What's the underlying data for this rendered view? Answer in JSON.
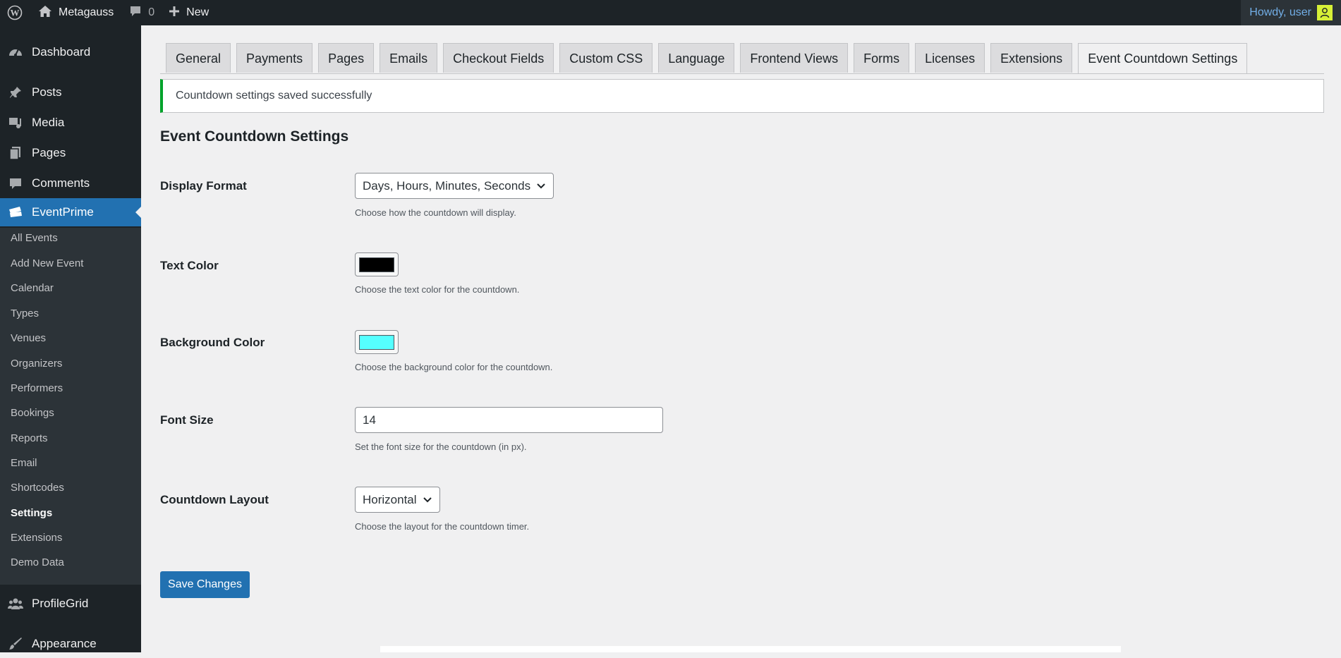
{
  "adminbar": {
    "site_name": "Metagauss",
    "comments_count": "0",
    "new_label": "New",
    "greeting": "Howdy, user"
  },
  "sidebar": {
    "top_items": [
      {
        "label": "Dashboard",
        "icon": "dashboard-icon"
      },
      {
        "label": "Posts",
        "icon": "pushpin-icon"
      },
      {
        "label": "Media",
        "icon": "media-icon"
      },
      {
        "label": "Pages",
        "icon": "pages-icon"
      },
      {
        "label": "Comments",
        "icon": "comment-icon"
      },
      {
        "label": "EventPrime",
        "icon": "tickets-icon"
      }
    ],
    "submenu": [
      "All Events",
      "Add New Event",
      "Calendar",
      "Types",
      "Venues",
      "Organizers",
      "Performers",
      "Bookings",
      "Reports",
      "Email",
      "Shortcodes",
      "Settings",
      "Extensions",
      "Demo Data"
    ],
    "current_submenu": "Settings",
    "bottom_items": [
      {
        "label": "ProfileGrid",
        "icon": "groups-icon"
      },
      {
        "label": "Appearance",
        "icon": "paintbrush-icon"
      }
    ]
  },
  "tabs": [
    "General",
    "Payments",
    "Pages",
    "Emails",
    "Checkout Fields",
    "Custom CSS",
    "Language",
    "Frontend Views",
    "Forms",
    "Licenses",
    "Extensions",
    "Event Countdown Settings"
  ],
  "active_tab": "Event Countdown Settings",
  "notice": "Countdown settings saved successfully",
  "section_title": "Event Countdown Settings",
  "fields": {
    "display_format": {
      "label": "Display Format",
      "value": "Days, Hours, Minutes, Seconds",
      "description": "Choose how the countdown will display."
    },
    "text_color": {
      "label": "Text Color",
      "color": "#000000",
      "description": "Choose the text color for the countdown."
    },
    "background_color": {
      "label": "Background Color",
      "color": "#55ffff",
      "description": "Choose the background color for the countdown."
    },
    "font_size": {
      "label": "Font Size",
      "value": "14",
      "description": "Set the font size for the countdown (in px)."
    },
    "countdown_layout": {
      "label": "Countdown Layout",
      "value": "Horizontal",
      "description": "Choose the layout for the countdown timer."
    }
  },
  "save_label": "Save Changes",
  "colors": {
    "admin_dark": "#1d2327",
    "accent": "#2271b1",
    "success": "#00a32a"
  }
}
